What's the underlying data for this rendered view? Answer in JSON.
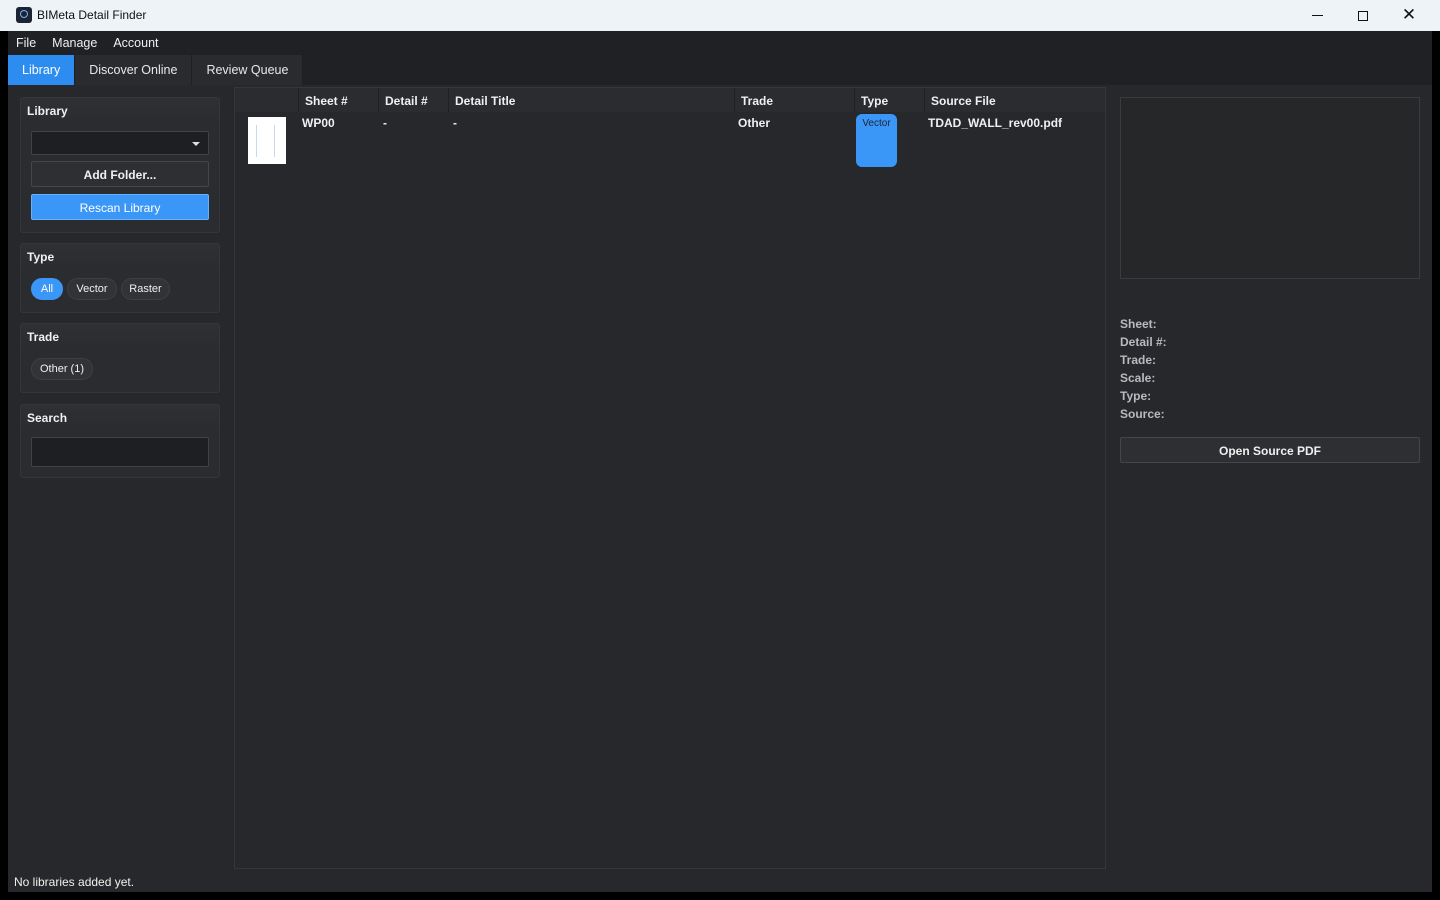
{
  "window": {
    "title": "BIMeta Detail Finder",
    "minimize_icon": "minimize-icon",
    "maximize_icon": "maximize-icon",
    "close_icon": "close-icon",
    "close_glyph": "✕"
  },
  "menu": {
    "items": [
      {
        "label": "File"
      },
      {
        "label": "Manage"
      },
      {
        "label": "Account"
      }
    ]
  },
  "tabs": [
    {
      "label": "Library",
      "active": true
    },
    {
      "label": "Discover Online",
      "active": false
    },
    {
      "label": "Review Queue",
      "active": false
    }
  ],
  "sidebar": {
    "library": {
      "heading": "Library",
      "selected_value": "",
      "add_folder_label": "Add Folder...",
      "rescan_label": "Rescan Library"
    },
    "type": {
      "heading": "Type",
      "chips": [
        {
          "label": "All",
          "selected": true
        },
        {
          "label": "Vector",
          "selected": false
        },
        {
          "label": "Raster",
          "selected": false
        }
      ]
    },
    "trade": {
      "heading": "Trade",
      "chips": [
        {
          "label": "Other (1)",
          "selected": false
        }
      ]
    },
    "search": {
      "heading": "Search",
      "value": "",
      "placeholder": ""
    }
  },
  "table": {
    "columns": [
      "",
      "Sheet #",
      "Detail #",
      "Detail Title",
      "Trade",
      "Type",
      "Source File"
    ],
    "rows": [
      {
        "sheet": "WP00",
        "detail": "-",
        "title": "-",
        "trade": "Other",
        "type": "Vector",
        "source": "TDAD_WALL_rev00.pdf"
      }
    ]
  },
  "details": {
    "sheet_label": "Sheet:",
    "detail_label": "Detail #:",
    "trade_label": "Trade:",
    "scale_label": "Scale:",
    "type_label": "Type:",
    "source_label": "Source:",
    "open_button_label": "Open Source PDF"
  },
  "status": {
    "text": "No libraries added yet."
  },
  "colors": {
    "accent": "#3a97f7",
    "background": "#27282b",
    "titlebar": "#eef3f8"
  }
}
